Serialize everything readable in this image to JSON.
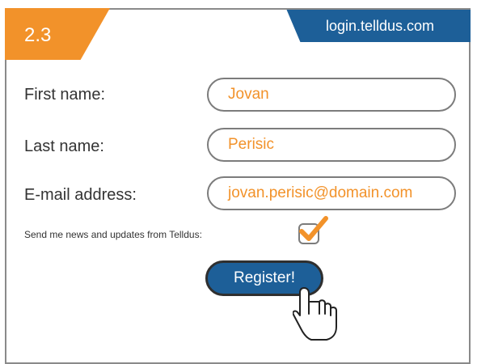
{
  "header": {
    "step": "2.3",
    "url": "login.telldus.com"
  },
  "form": {
    "first_name": {
      "label": "First name:",
      "value": "Jovan"
    },
    "last_name": {
      "label": "Last name:",
      "value": "Perisic"
    },
    "email": {
      "label": "E-mail address:",
      "value": "jovan.perisic@domain.com"
    },
    "newsletter": {
      "label": "Send me news and updates from Telldus:",
      "checked": true
    },
    "submit_label": "Register!"
  },
  "colors": {
    "accent_orange": "#f2922a",
    "brand_blue": "#1d5f98",
    "border_gray": "#7c7c7c"
  },
  "icons": {
    "checkbox": "checkmark-icon",
    "cursor": "hand-pointer-icon"
  }
}
